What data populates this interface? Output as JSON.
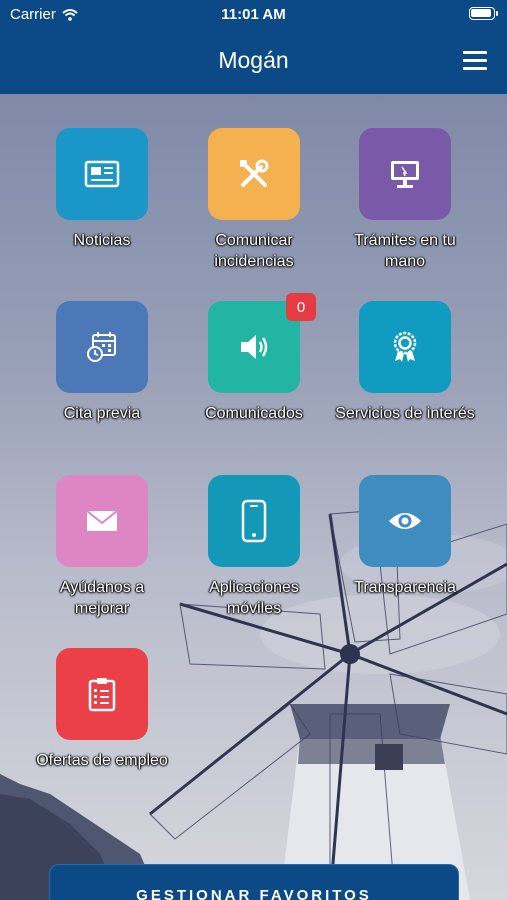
{
  "status": {
    "carrier": "Carrier",
    "time": "11:01 AM"
  },
  "header": {
    "title": "Mogán"
  },
  "tiles": [
    {
      "label": "Noticias",
      "icon": "newspaper-icon",
      "color": "#1a97c8"
    },
    {
      "label": "Comunicar incidencias",
      "icon": "tools-icon",
      "color": "#f5b150"
    },
    {
      "label": "Trámites en tu mano",
      "icon": "computer-icon",
      "color": "#7a5aa8"
    },
    {
      "label": "Cita previa",
      "icon": "calendar-clock-icon",
      "color": "#4d78b8"
    },
    {
      "label": "Comunicados",
      "icon": "speaker-icon",
      "color": "#22b5a4",
      "badge": "0"
    },
    {
      "label": "Servicios de interés",
      "icon": "award-icon",
      "color": "#0f9cc0"
    },
    {
      "label": "Ayúdanos a mejorar",
      "icon": "mail-icon",
      "color": "#de86c3"
    },
    {
      "label": "Aplicaciones móviles",
      "icon": "mobile-icon",
      "color": "#1398b8"
    },
    {
      "label": "Transparencia",
      "icon": "eye-icon",
      "color": "#3f8dc0"
    },
    {
      "label": "Ofertas de empleo",
      "icon": "clipboard-icon",
      "color": "#ec4048"
    }
  ],
  "footer": {
    "button_label": "GESTIONAR FAVORITOS"
  }
}
